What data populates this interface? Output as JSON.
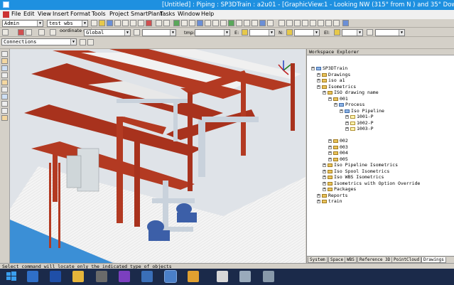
{
  "window": {
    "title": "[Untitled] : Piping : SP3DTrain : a2u01 - [GraphicView:1 - Looking NW (315° from N ) and 35° Down]"
  },
  "menu": [
    "File",
    "Edit",
    "View",
    "Insert",
    "Format",
    "Tools",
    "Project",
    "SmartPlant",
    "Tasks",
    "Window",
    "Help"
  ],
  "toolbar": {
    "user_combo": "Admin",
    "wbs_combo": "test wbs",
    "coord_label": "oordinate\nsystem:",
    "coord_combo": "Global",
    "temp_label": "tmp:",
    "e_label": "E:",
    "n_label": "N:",
    "el_label": "El:",
    "filter_combo": "Connections"
  },
  "explorer": {
    "title": "Workspace Explorer",
    "tree": [
      {
        "label": "SP3DTrain",
        "level": 0,
        "icon": "blue"
      },
      {
        "label": "Drawings",
        "level": 1,
        "icon": "folder"
      },
      {
        "label": "iso a1",
        "level": 1,
        "icon": "folder"
      },
      {
        "label": "Isometrics",
        "level": 1,
        "icon": "folder"
      },
      {
        "label": "ISO drawing name",
        "level": 2,
        "icon": "folder"
      },
      {
        "label": "001",
        "level": 3,
        "icon": "folder"
      },
      {
        "label": "Process",
        "level": 4,
        "icon": "blue"
      },
      {
        "label": "Iso Pipeline",
        "level": 5,
        "icon": "blue"
      },
      {
        "label": "1001-P",
        "level": 6,
        "icon": "doc"
      },
      {
        "label": "1002-P",
        "level": 6,
        "icon": "doc"
      },
      {
        "label": "1003-P",
        "level": 6,
        "icon": "doc"
      },
      {
        "label": "",
        "level": 0,
        "icon": "none"
      },
      {
        "label": "002",
        "level": 3,
        "icon": "folder"
      },
      {
        "label": "003",
        "level": 3,
        "icon": "folder"
      },
      {
        "label": "004",
        "level": 3,
        "icon": "folder"
      },
      {
        "label": "005",
        "level": 3,
        "icon": "folder"
      },
      {
        "label": "Iso Pipeline Isometrics",
        "level": 2,
        "icon": "folder"
      },
      {
        "label": "Iso Spool Isometrics",
        "level": 2,
        "icon": "folder"
      },
      {
        "label": "Iso WBS Isometrics",
        "level": 2,
        "icon": "folder"
      },
      {
        "label": "Isometrics with Option Override",
        "level": 2,
        "icon": "folder"
      },
      {
        "label": "Packages",
        "level": 2,
        "icon": "folder"
      },
      {
        "label": "Reports",
        "level": 1,
        "icon": "folder"
      },
      {
        "label": "train",
        "level": 1,
        "icon": "folder"
      }
    ],
    "tabs": [
      "System",
      "Space",
      "WBS",
      "Reference 3D",
      "PointCloud",
      "Drawings"
    ],
    "active_tab": "Drawings"
  },
  "status": {
    "text": "Select command will locate only the indicated type of objects"
  },
  "taskbar": {
    "icons": [
      "windows-start",
      "people-app",
      "powershell",
      "file-explorer",
      "notepad-keys",
      "visual-studio",
      "smartplant-3d",
      "smartplant-3d-active",
      "paint",
      "pdf-reader",
      "tools-app",
      "network-app"
    ]
  },
  "colors": {
    "title_bar": "#1e90e0",
    "steel": "#b33a22",
    "floor": "#f2f2f2",
    "pipe": "#c9d2dc",
    "pump": "#3c5fa8",
    "taskbar": "#1b2a4a"
  }
}
